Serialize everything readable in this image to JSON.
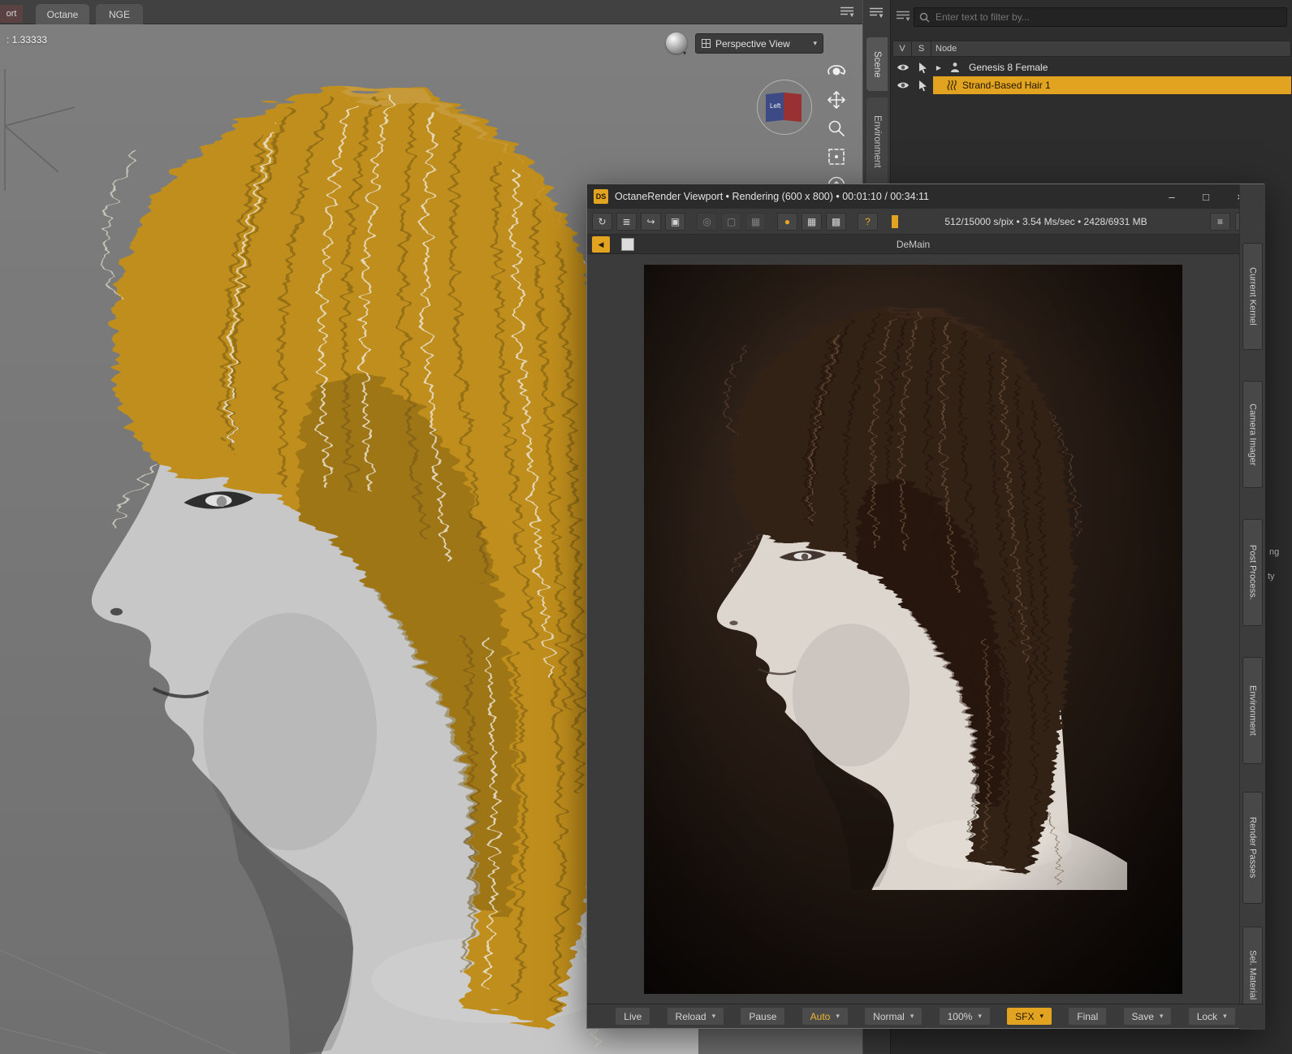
{
  "colors": {
    "accent": "#e2a321",
    "selection_row": "#e2a321",
    "viewport_bg": "#767676",
    "panel_bg": "#2d2d2d"
  },
  "tabbar": {
    "partial_tab": "ort",
    "tabs": [
      "Octane",
      "NGE"
    ]
  },
  "viewport": {
    "ratio_label": ": 1.33333",
    "view_selector": "Perspective View",
    "nav_cube_label": "Left"
  },
  "dock": {
    "tab_scene": "Scene",
    "tab_environment": "Environment"
  },
  "scene_panel": {
    "filter_placeholder": "Enter text to filter by...",
    "columns": {
      "v": "V",
      "s": "S",
      "node": "Node"
    },
    "rows": [
      {
        "label": "Genesis 8 Female",
        "selected": false
      },
      {
        "label": "Strand-Based Hair 1",
        "selected": true
      }
    ]
  },
  "octane": {
    "title": "OctaneRender Viewport • Rendering (600 x 800) • 00:01:10 / 00:34:11",
    "app_badge": "DS",
    "status": "512/15000 s/pix • 3.54 Ms/sec • 2428/6931 MB",
    "tab_label": "DeMain",
    "right_tabs": [
      "Current Kernel",
      "Camera Imager",
      "Post Process.",
      "Environment",
      "Render Passes",
      "Sel. Material"
    ],
    "buttons": [
      {
        "label": "Live",
        "dropdown": false
      },
      {
        "label": "Reload",
        "dropdown": true
      },
      {
        "label": "Pause",
        "dropdown": false
      },
      {
        "label": "Auto",
        "dropdown": true
      },
      {
        "label": "Normal",
        "dropdown": true
      },
      {
        "label": "100%",
        "dropdown": true
      },
      {
        "label": "SFX",
        "dropdown": true
      },
      {
        "label": "Final",
        "dropdown": false
      },
      {
        "label": "Save",
        "dropdown": true
      },
      {
        "label": "Lock",
        "dropdown": true
      }
    ]
  },
  "edge_labels": [
    "ng",
    "ty"
  ],
  "icons": {
    "dropdown": "▾",
    "back": "◀",
    "expander": "▶",
    "minimize": "–",
    "maximize": "□",
    "close": "×",
    "refresh": "↻",
    "channels": "≣",
    "send": "↪",
    "fit": "▣",
    "target": "◎",
    "region": "▢",
    "tiles": "▦",
    "render_sphere": "●",
    "grid": "▦",
    "picture": "▩",
    "help": "?",
    "list": "≡",
    "camera": "▣"
  }
}
